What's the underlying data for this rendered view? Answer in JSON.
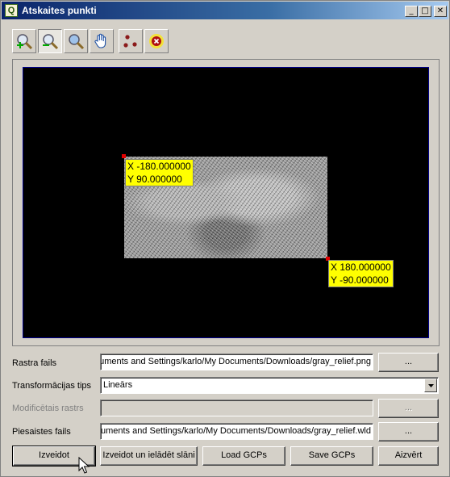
{
  "window": {
    "title": "Atskaites punkti",
    "app_icon_letter": "Q",
    "controls": {
      "minimize": "_",
      "maximize": "□",
      "close": "✕"
    }
  },
  "toolbar": {
    "tools": [
      {
        "name": "zoom-in",
        "icon": "zoom-in-icon",
        "pressed": false
      },
      {
        "name": "zoom-out",
        "icon": "zoom-out-icon",
        "pressed": true
      },
      {
        "name": "zoom-to-layer",
        "icon": "zoom-layer-icon",
        "pressed": false
      },
      {
        "name": "pan",
        "icon": "hand-icon",
        "pressed": false
      },
      {
        "name": "add-point",
        "icon": "add-point-icon",
        "pressed": false
      },
      {
        "name": "delete-point",
        "icon": "delete-point-icon",
        "pressed": false
      }
    ]
  },
  "canvas": {
    "points": [
      {
        "x_label": "X -180.000000",
        "y_label": "Y 90.000000"
      },
      {
        "x_label": "X 180.000000",
        "y_label": "Y -90.000000"
      }
    ],
    "colors": {
      "background": "#000000",
      "point": "#e00000",
      "label_bg": "#ffff00"
    }
  },
  "form": {
    "raster_file": {
      "label": "Rastra fails",
      "value": "C:/Documents and Settings/karlo/My Documents/Downloads/gray_relief.png",
      "browse": "..."
    },
    "transform_type": {
      "label": "Transformācijas tips",
      "value": "Lineārs"
    },
    "modified_raster": {
      "label": "Modificētais rastrs",
      "value": "",
      "browse": "..."
    },
    "world_file": {
      "label": "Piesaistes fails",
      "value": "C:/Documents and Settings/karlo/My Documents/Downloads/gray_relief.wld",
      "browse": "..."
    }
  },
  "buttons": {
    "create": "Izveidot",
    "create_and_load": "Izveidot un ielādēt slāni",
    "load_gcps": "Load GCPs",
    "save_gcps": "Save GCPs",
    "close": "Aizvērt"
  }
}
